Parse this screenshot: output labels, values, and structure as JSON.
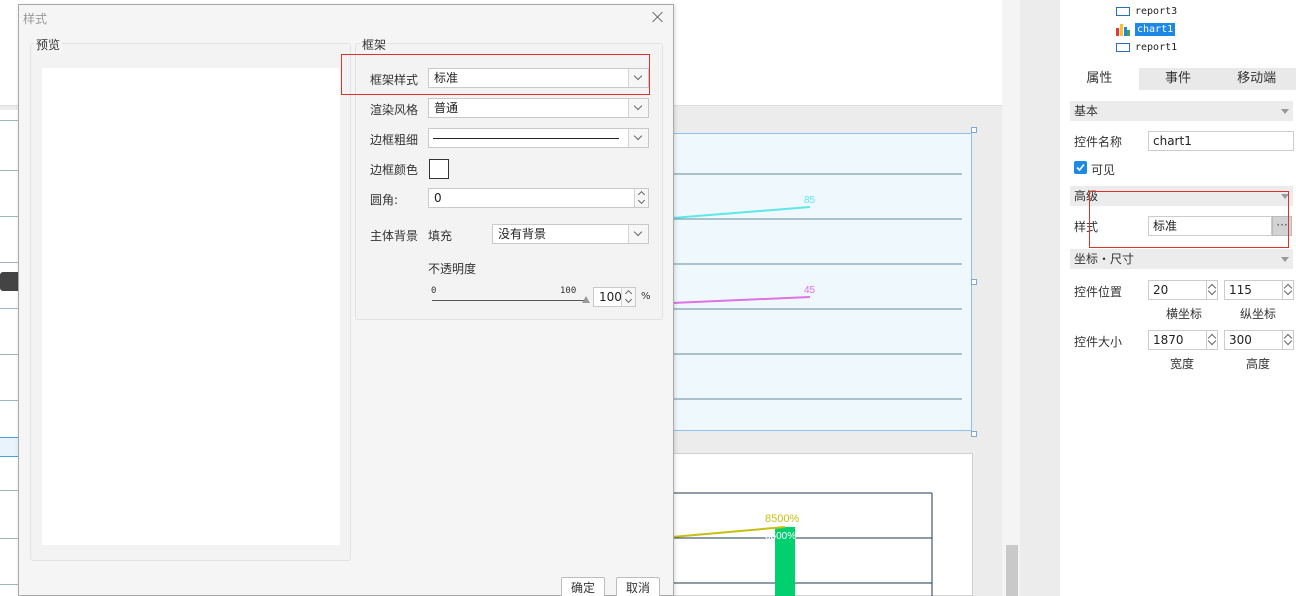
{
  "dialog": {
    "title": "样式",
    "preview_label": "预览",
    "frame_group_label": "框架",
    "frame_style_label": "框架样式",
    "frame_style_value": "标准",
    "render_style_label": "渲染风格",
    "render_style_value": "普通",
    "border_width_label": "边框粗细",
    "border_color_label": "边框颜色",
    "corner_label": "圆角:",
    "corner_value": "0",
    "main_bg_label": "主体背景",
    "fill_label": "填充",
    "fill_value": "没有背景",
    "opacity_label": "不透明度",
    "opacity_min": "0",
    "opacity_max": "100",
    "opacity_value": "100",
    "opacity_unit": "%",
    "opacity_level": 1.0,
    "ok_button": "确定",
    "cancel_button": "取消"
  },
  "tree": {
    "items": [
      {
        "label": "report3",
        "type": "report"
      },
      {
        "label": "chart1",
        "type": "chart",
        "selected": true
      },
      {
        "label": "report1",
        "type": "report"
      }
    ]
  },
  "properties": {
    "tabs": [
      "属性",
      "事件",
      "移动端"
    ],
    "active_tab": "属性",
    "basic_header": "基本",
    "control_name_label": "控件名称",
    "control_name_value": "chart1",
    "visible_label": "可见",
    "visible_checked": true,
    "advanced_header": "高级",
    "style_label": "样式",
    "style_value": "标准",
    "ellipsis": "···",
    "coords_header": "坐标・尺寸",
    "position_label": "控件位置",
    "pos_x": "20",
    "pos_y": "115",
    "x_label": "横坐标",
    "y_label": "纵坐标",
    "size_label": "控件大小",
    "width_value": "1870",
    "height_value": "300",
    "width_label": "宽度",
    "height_label": "高度"
  },
  "background_chart": {
    "label_85": "85",
    "label_45": "45",
    "label_8500": "8500%",
    "label_8500_bar": "8500%",
    "colors": {
      "cyan_line": "#5ce8e8",
      "magenta_line": "#e070e6",
      "yellow_line": "#c8be10",
      "green_bar": "#00d06e",
      "selection": "#8dc1ee",
      "highlight": "#e0302a",
      "selected_item": "#1e88e5"
    }
  }
}
